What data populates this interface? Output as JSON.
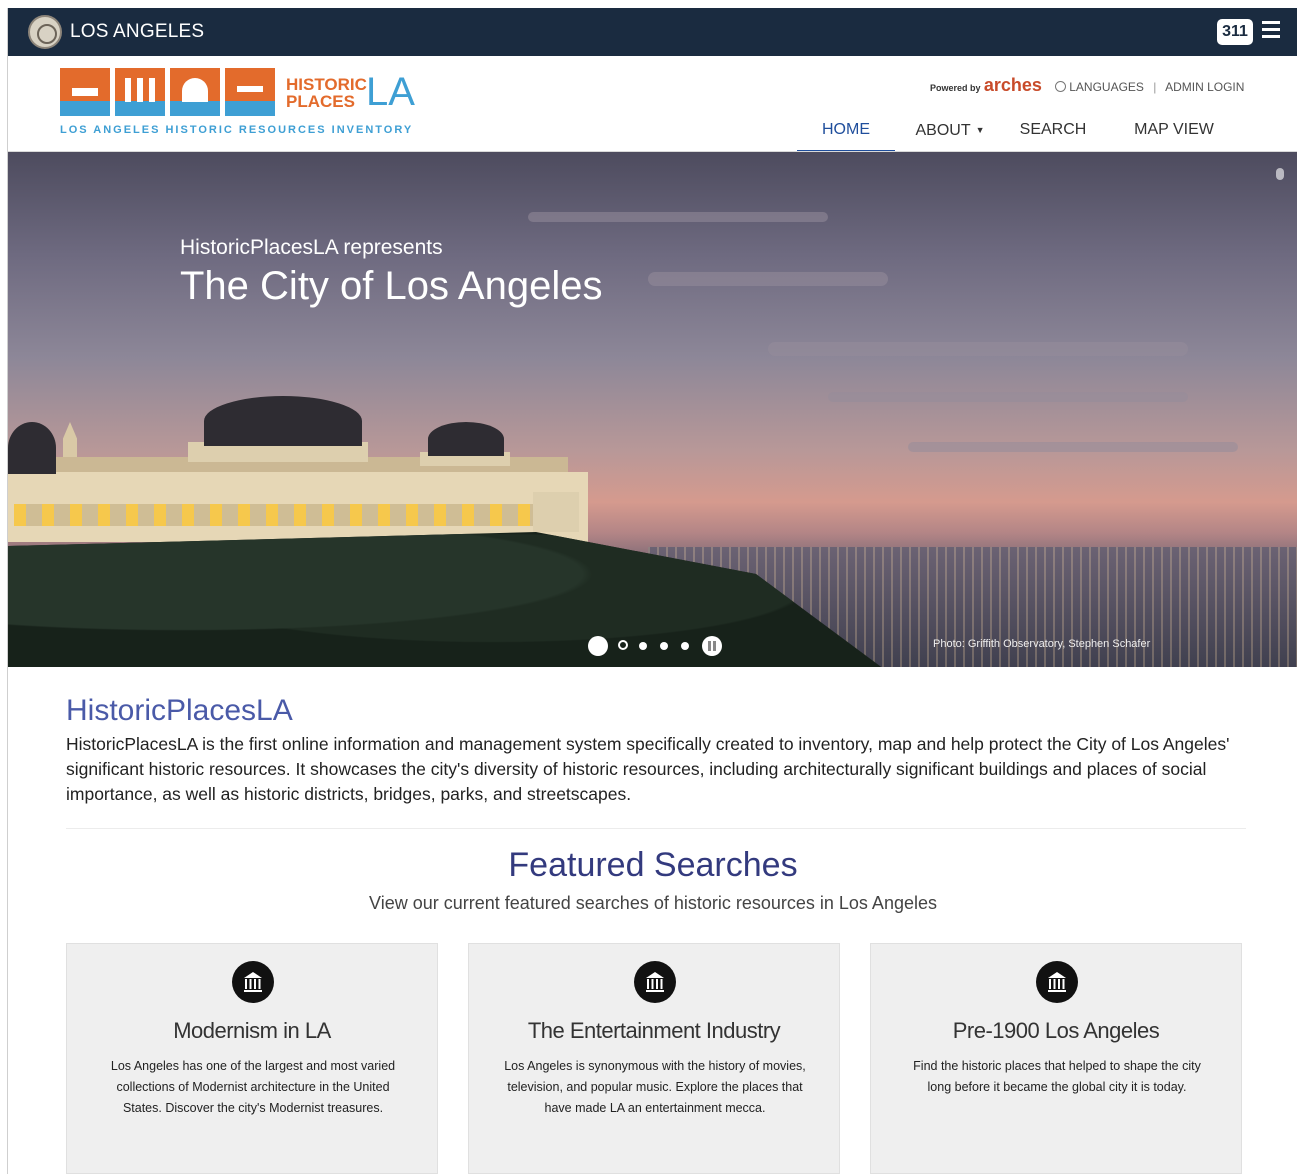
{
  "citybar": {
    "city_name": "LOS ANGELES",
    "badge": "311",
    "menu_icon": "hamburger-icon"
  },
  "logo": {
    "historic": "HISTORIC",
    "places": "PLACES",
    "la": "LA",
    "tagline": "LOS ANGELES HISTORIC RESOURCES INVENTORY"
  },
  "utility": {
    "powered_by": "Powered by",
    "arches": "arches",
    "languages": "LANGUAGES",
    "separator": "|",
    "admin_login": "ADMIN LOGIN"
  },
  "nav": [
    {
      "label": "HOME",
      "active": true
    },
    {
      "label": "ABOUT",
      "has_caret": true
    },
    {
      "label": "SEARCH"
    },
    {
      "label": "MAP VIEW"
    }
  ],
  "hero": {
    "kicker": "HistoricPlacesLA represents",
    "title": "The City of Los Angeles",
    "photo_credit": "Photo: Griffith Observatory, Stephen Schafer",
    "slides": 5,
    "active_slide": 1
  },
  "intro": {
    "title": "HistoricPlacesLA",
    "text": "HistoricPlacesLA is the first online information and management system specifically created to inventory, map and help protect the City of Los Angeles' significant historic resources. It showcases the city's diversity of historic resources, including architecturally significant buildings and places of social importance, as well as historic districts, bridges, parks, and streetscapes."
  },
  "featured": {
    "title": "Featured Searches",
    "subtitle": "View our current featured searches of historic resources in Los Angeles",
    "cards": [
      {
        "icon": "museum-icon",
        "title": "Modernism in LA",
        "body": "Los Angeles has one of the largest and most varied collections of Modernist architecture in the United States. Discover the city's Modernist treasures."
      },
      {
        "icon": "museum-icon",
        "title": "The Entertainment Industry",
        "body": "Los Angeles is synonymous with the history of movies, television, and popular music. Explore the places that have made LA an entertainment mecca."
      },
      {
        "icon": "museum-icon",
        "title": "Pre-1900 Los Angeles",
        "body": "Find the historic places that helped to shape the city long before it became the global city it is today."
      }
    ]
  },
  "colors": {
    "citybar": "#1a2b40",
    "nav_active": "#1f4e9c",
    "logo_orange": "#e36b2c",
    "logo_blue": "#3e9fd4",
    "featured_title": "#333a7e",
    "intro_title": "#4a5aa8"
  }
}
